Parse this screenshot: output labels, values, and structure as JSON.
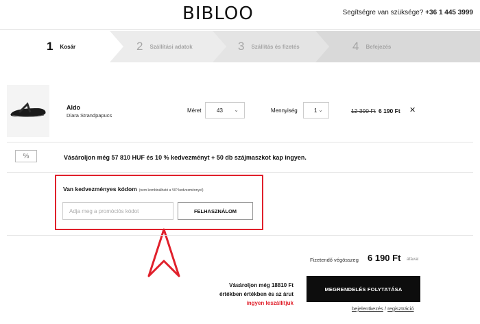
{
  "header": {
    "logo": "BIBLOO",
    "help_text": "Segítségre van szüksége?",
    "phone": "+36 1 445 3999"
  },
  "steps": [
    {
      "num": "1",
      "label": "Kosár",
      "active": true
    },
    {
      "num": "2",
      "label": "Szállítási adatok",
      "active": false
    },
    {
      "num": "3",
      "label": "Szállítás és fizetés",
      "active": false
    },
    {
      "num": "4",
      "label": "Befejezés",
      "active": false
    }
  ],
  "product": {
    "image_icon": "flip-flop-sandal-icon",
    "name": "Aldo",
    "description": "Diara Strandpapucs",
    "size_label": "Méret",
    "size_value": "43",
    "qty_label": "Mennyiség",
    "qty_value": "1",
    "old_price": "12 390 Ft",
    "new_price": "6 190 Ft",
    "remove_icon": "✕"
  },
  "promo": {
    "icon": "%",
    "text": "Vásároljon még 57 810 HUF és 10 % kedvezményt + 50 db szájmaszkot kap ingyen."
  },
  "coupon": {
    "title": "Van kedvezményes kódom",
    "note": "(nem kombinálható a VIP kedvezménnyel)",
    "placeholder": "Adja meg a promóciós kódot",
    "button": "FELHASZNÁLOM",
    "highlight_color": "#e0202b"
  },
  "totals": {
    "label": "Fizetendő végösszeg",
    "value": "6 190 Ft",
    "vat": "áfával"
  },
  "shipping": {
    "line1": "Vásároljon még 18810 Ft",
    "line2": "értékben értékben és az árut",
    "line3": "ingyen leszállítjuk"
  },
  "checkout": {
    "button": "MEGRENDELÉS FOLYTATÁSA",
    "login": "bejelentkezés",
    "separator": "/",
    "register": "regisztráció"
  }
}
